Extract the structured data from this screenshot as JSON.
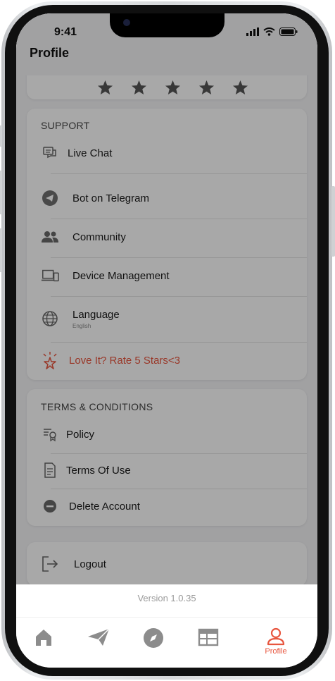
{
  "status_bar": {
    "time": "9:41"
  },
  "header": {
    "title": "Profile"
  },
  "rating": {
    "stars": 5
  },
  "support": {
    "title": "SUPPORT",
    "items": [
      {
        "label": "Live Chat",
        "icon": "chat-icon"
      },
      {
        "label": "Bot on Telegram",
        "icon": "telegram-icon"
      },
      {
        "label": "Community",
        "icon": "people-icon"
      },
      {
        "label": "Device Management",
        "icon": "devices-icon"
      },
      {
        "label": "Language",
        "sub": "English",
        "icon": "globe-icon"
      },
      {
        "label": "Love It? Rate 5 Stars<3",
        "icon": "sparkle-star-icon"
      }
    ]
  },
  "terms": {
    "title": "TERMS & CONDITIONS",
    "items": [
      {
        "label": "Policy",
        "icon": "policy-icon"
      },
      {
        "label": "Terms Of Use",
        "icon": "document-icon"
      },
      {
        "label": "Delete Account",
        "icon": "minus-circle-icon"
      }
    ]
  },
  "logout": {
    "label": "Logout",
    "icon": "logout-icon"
  },
  "footer": {
    "version": "Version 1.0.35"
  },
  "tabbar": {
    "items": [
      {
        "name": "home",
        "icon": "home-icon"
      },
      {
        "name": "send",
        "icon": "paper-plane-icon"
      },
      {
        "name": "explore",
        "icon": "compass-icon"
      },
      {
        "name": "schedule",
        "icon": "table-icon"
      },
      {
        "name": "profile",
        "icon": "person-icon",
        "label": "Profile",
        "active": true
      }
    ]
  },
  "colors": {
    "accent": "#e8563f",
    "icon_inactive": "#8c8c8c",
    "overlay": "rgba(0,0,0,0.34)"
  }
}
